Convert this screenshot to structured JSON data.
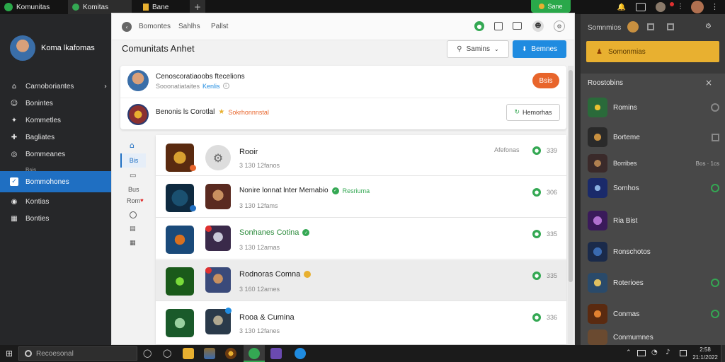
{
  "topbar": {
    "app_name": "Komunitas",
    "tabs": [
      {
        "label": "Komitas"
      },
      {
        "label": "Bane"
      }
    ],
    "badge": "Sane"
  },
  "sidebar": {
    "username": "Koma lkafomas",
    "items": [
      {
        "label": "Carnoboriantes",
        "icon": "home-icon"
      },
      {
        "label": "Bonintes",
        "icon": "people-icon"
      },
      {
        "label": "Kommetles",
        "icon": "puzzle-icon"
      },
      {
        "label": "Bagliates",
        "icon": "gamepad-icon"
      },
      {
        "label": "Bommeanes",
        "icon": "globe-icon"
      },
      {
        "label": "Bommohones",
        "icon": "check-icon"
      },
      {
        "label": "Kontias",
        "icon": "circle-icon"
      },
      {
        "label": "Bonties",
        "icon": "grid-icon"
      }
    ],
    "divider_label": "Bsis"
  },
  "main": {
    "header_tabs": [
      "Bomontes",
      "Sahlhs",
      "Pallst"
    ],
    "title": "Comunitats Anhet",
    "dropdown_label": "Samins",
    "primary_button": "Bemnes",
    "notifications": [
      {
        "title": "Cenoscoratiaoobs ftecelions",
        "sub": "Sooonatiataites",
        "sub_link": "Kenlis",
        "button": "Bsis"
      },
      {
        "title": "Benonis ls Corotlal",
        "highlight": "Sokrhonnnstal",
        "button": "Hemorhas"
      }
    ],
    "left_nav": [
      "Bis",
      "Bus",
      "Rom"
    ],
    "list": [
      {
        "title": "Rooir",
        "meta": "3 130 12fanos",
        "status": "Afefonas",
        "count": "339"
      },
      {
        "title": "Nonire lonnat lnter Memabio",
        "status": "Resriuma",
        "meta": "3 130 12fams",
        "count": "306"
      },
      {
        "title": "Sonhanes Cotina",
        "meta": "3 130 12amas",
        "count": "335"
      },
      {
        "title": "Rodnoras Comna",
        "meta": "3 160 12ames",
        "count": "335"
      },
      {
        "title": "Rooa & Cumina",
        "meta": "3 130 12fanes",
        "count": "336"
      }
    ]
  },
  "right_panel": {
    "top_label": "Somnmios",
    "highlight_button": "Somonmias",
    "heading": "Roostobins",
    "items": [
      {
        "label": "Romins"
      },
      {
        "label": "Borteme"
      },
      {
        "label": "Borribes",
        "extra": "Bos · 1cs"
      },
      {
        "label": "Somhos"
      },
      {
        "label": "Ria Bist"
      },
      {
        "label": "Ronschotos"
      },
      {
        "label": "Roterioes"
      },
      {
        "label": "Conmas"
      },
      {
        "label": "Conmumnes"
      }
    ]
  },
  "taskbar": {
    "search_placeholder": "Recoesonal",
    "clock_time": "2:58",
    "clock_date": "21:1/2022"
  },
  "colors": {
    "accent_blue": "#1f6fc2",
    "accent_orange": "#e8652b",
    "accent_green": "#34a853",
    "highlight_yellow": "#e8b030"
  }
}
